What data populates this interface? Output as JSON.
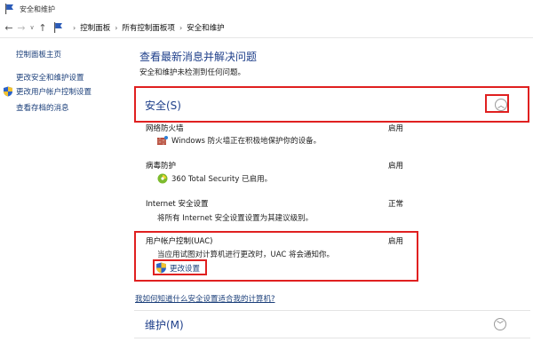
{
  "window": {
    "title": "安全和维护"
  },
  "nav": {
    "back": "←",
    "forward": "→",
    "recent": "∨",
    "up": "↑"
  },
  "breadcrumb": [
    {
      "label": "控制面板"
    },
    {
      "label": "所有控制面板项"
    },
    {
      "label": "安全和维护"
    }
  ],
  "sidebar": {
    "items": [
      {
        "label": "控制面板主页"
      },
      {
        "label": "更改安全和维护设置"
      },
      {
        "label": "更改用户帐户控制设置"
      },
      {
        "label": "查看存档的消息"
      }
    ]
  },
  "main": {
    "heading": "查看最新消息并解决问题",
    "subheading": "安全和维护未检测到任何问题。",
    "security": {
      "label": "安全(S)",
      "items": [
        {
          "title": "网络防火墙",
          "status": "启用",
          "desc": "Windows 防火墙正在积极地保护你的设备。"
        },
        {
          "title": "病毒防护",
          "status": "启用",
          "desc": "360 Total Security 已启用。"
        },
        {
          "title": "Internet 安全设置",
          "status": "正常",
          "desc": "将所有 Internet 安全设置设置为其建议级别。"
        },
        {
          "title": "用户帐户控制(UAC)",
          "status": "启用",
          "desc": "当应用试图对计算机进行更改时，UAC 将会通知你。"
        }
      ],
      "change_settings": "更改设置"
    },
    "help_link": "我如何知道什么安全设置适合我的计算机?",
    "maintenance": {
      "label": "维护(M)"
    }
  },
  "colors": {
    "link": "#1b3f7a",
    "heading": "#1e3f8a",
    "highlight": "#e02020"
  }
}
